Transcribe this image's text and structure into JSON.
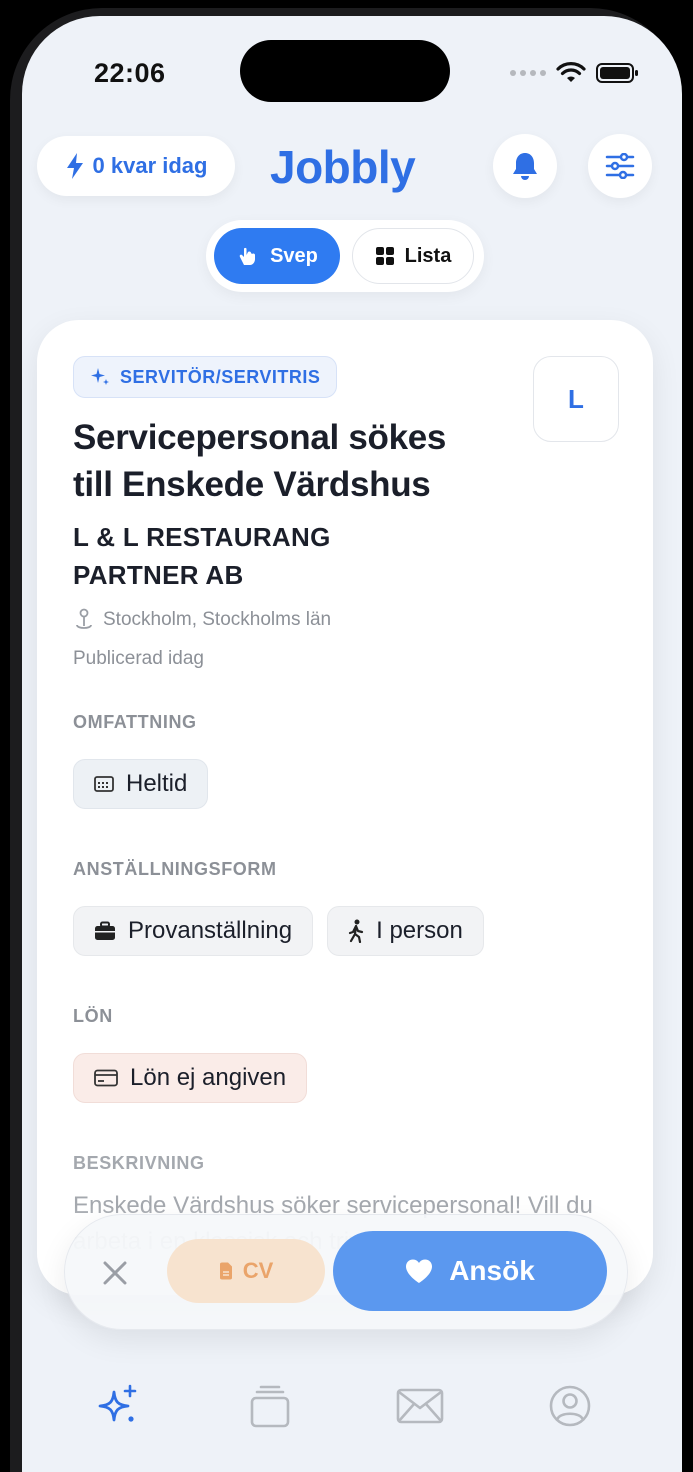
{
  "status": {
    "time": "22:06"
  },
  "header": {
    "remaining_label": "0 kvar idag",
    "app_title": "Jobbly"
  },
  "view_toggle": {
    "swipe_label": "Svep",
    "list_label": "Lista"
  },
  "job": {
    "category": "SERVITÖR/SERVITRIS",
    "logo_letter": "L",
    "title": "Servicepersonal sökes till Enskede Värdshus",
    "company": "L & L RESTAURANG PARTNER AB",
    "location": "Stockholm, Stockholms län",
    "published": "Publicerad idag",
    "sections": {
      "scope_label": "OMFATTNING",
      "scope_value": "Heltid",
      "employment_label": "ANSTÄLLNINGSFORM",
      "employment_value": "Provanställning",
      "work_mode_value": "I person",
      "salary_label": "LÖN",
      "salary_value": "Lön ej angiven",
      "description_label": "BESKRIVNING",
      "description_text": "Enskede Värdshus söker servicepersonal! Vill du arbeta i en klassisk och trivsam"
    }
  },
  "actions": {
    "cv_label": "CV",
    "apply_label": "Ansök"
  },
  "colors": {
    "accent": "#2f6fe4",
    "apply": "#5b98ef",
    "cv_bg": "#f7e3cf",
    "cv_text": "#eaa46a"
  }
}
